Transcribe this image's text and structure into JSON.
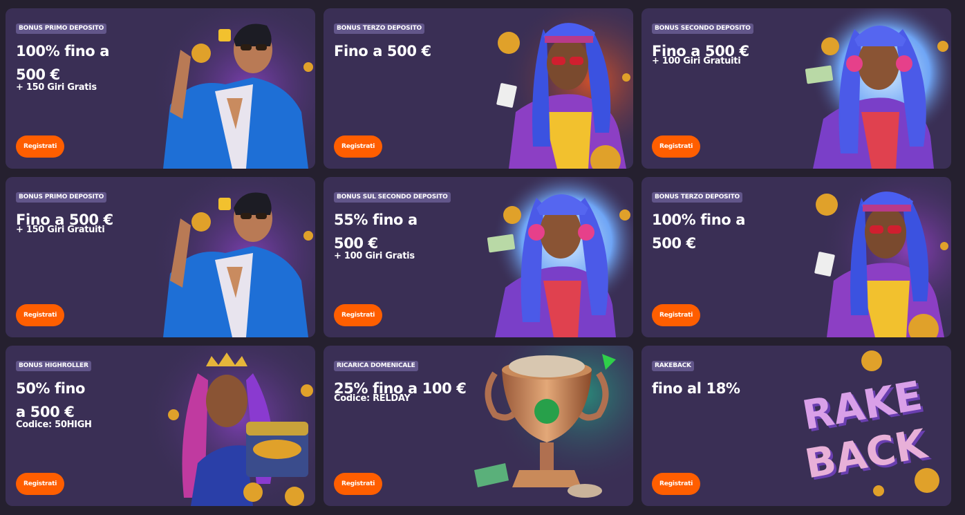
{
  "colors": {
    "page_bg": "#25202f",
    "card_bg": "#3a2f55",
    "badge_bg": "#62568a",
    "button_bg": "#ff5e00"
  },
  "cards": [
    {
      "badge": "BONUS PRIMO DEPOSITO",
      "title": "100% fino a 500 €",
      "subtitle": "+ 150 Giri Gratis",
      "button": "Registrati",
      "art": "man-blue-suit-illustration"
    },
    {
      "badge": "BONUS TERZO DEPOSITO",
      "title": "Fino a 500 €",
      "subtitle": "",
      "button": "Registrati",
      "art": "woman-yellow-top-illustration"
    },
    {
      "badge": "BONUS SECONDO DEPOSITO",
      "title": "Fino a 500 €",
      "subtitle": "+ 100 Giri Gratuiti",
      "button": "Registrati",
      "art": "woman-headphones-illustration"
    },
    {
      "badge": "BONUS PRIMO DEPOSITO",
      "title": "Fino a 500 €",
      "subtitle": "+ 150 Giri Gratuiti",
      "button": "Registrati",
      "art": "man-blue-suit-illustration"
    },
    {
      "badge": "BONUS SUL SECONDO DEPOSITO",
      "title": "55% fino a 500 €",
      "subtitle": "+ 100 Giri Gratis",
      "button": "Registrati",
      "art": "woman-headphones-illustration"
    },
    {
      "badge": "BONUS TERZO DEPOSITO",
      "title": "100% fino a 500 €",
      "subtitle": "",
      "button": "Registrati",
      "art": "woman-yellow-top-illustration"
    },
    {
      "badge": "BONUS HIGHROLLER",
      "title": "50% fino a 500 €",
      "subtitle": "Codice: 50HIGH",
      "button": "Registrati",
      "art": "queen-treasure-illustration"
    },
    {
      "badge": "RICARICA DOMENICALE",
      "title": "25% fino a 100 €",
      "subtitle": "Codice: RELDAY",
      "button": "Registrati",
      "art": "trophy-coins-illustration"
    },
    {
      "badge": "RAKEBACK",
      "title": "fino al 18%",
      "subtitle": "",
      "button": "Registrati",
      "art": "rakeback-logo",
      "art_text": [
        "RAKE",
        "BACK"
      ]
    }
  ]
}
